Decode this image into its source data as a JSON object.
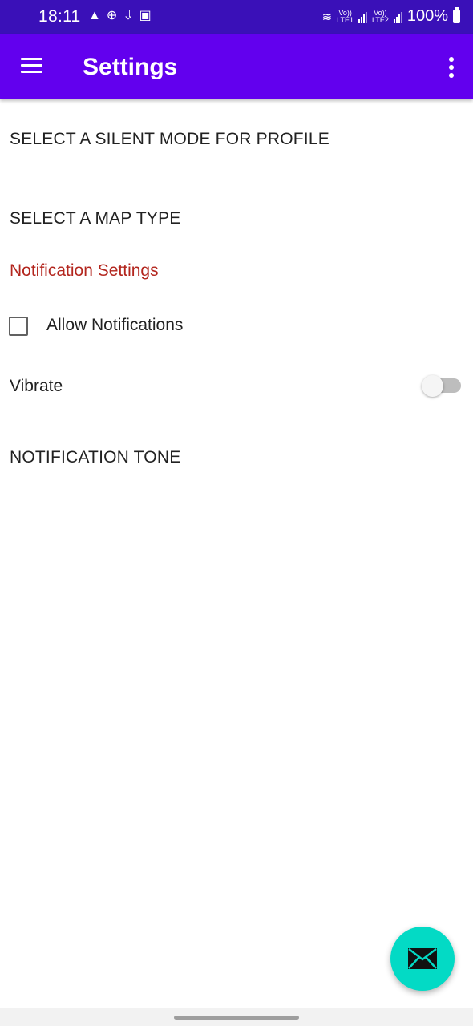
{
  "status_bar": {
    "time": "18:11",
    "left_icons": [
      "warning-icon",
      "network-icon",
      "download-icon",
      "image-icon"
    ],
    "net1": "Vo))\nLTE1",
    "net2": "Vo))\nLTE2",
    "battery": "100%"
  },
  "app_bar": {
    "title": "Settings"
  },
  "prefs": {
    "silent_mode": "SELECT A SILENT MODE FOR PROFILE",
    "map_type": "SELECT A MAP TYPE",
    "notification_category": "Notification Settings",
    "allow_notifications": "Allow Notifications",
    "allow_notifications_checked": false,
    "vibrate": "Vibrate",
    "vibrate_on": false,
    "notification_tone": "NOTIFICATION TONE"
  },
  "fab": {
    "icon": "mail-icon"
  },
  "colors": {
    "status_bar": "#3a10b8",
    "app_bar": "#6200ee",
    "category_text": "#b3261e",
    "fab": "#03dac5"
  }
}
